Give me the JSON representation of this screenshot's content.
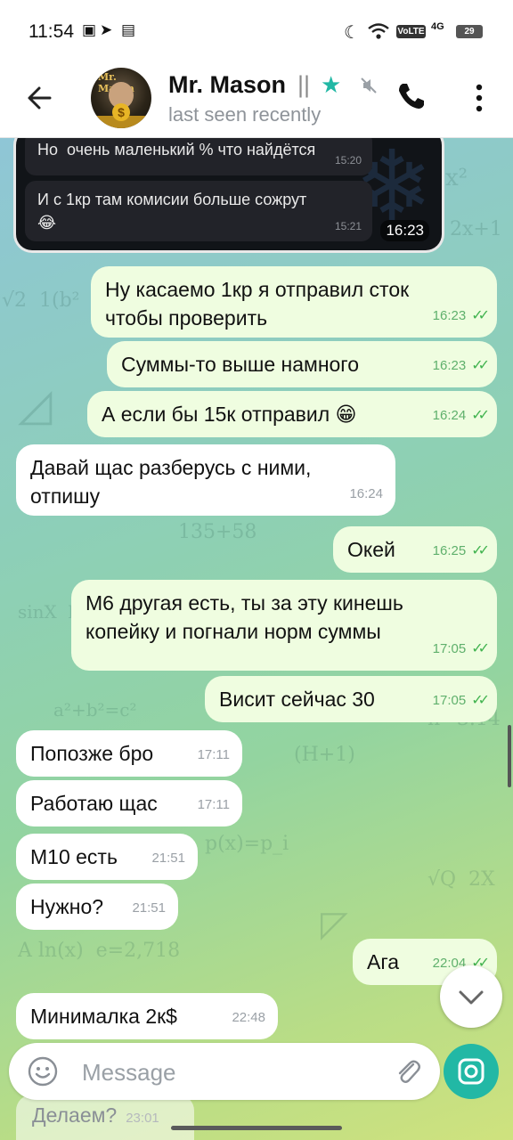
{
  "status_bar": {
    "time": "11:54",
    "indicators": [
      "moon-icon",
      "wifi-icon",
      "volte",
      "4g",
      "battery"
    ],
    "volte": "VoLTE",
    "network": "4G",
    "battery": "29"
  },
  "header": {
    "contact_name": "Mr. Mason",
    "separator": "||",
    "status": "last seen recently",
    "avatar_caption": "Mr. Mason"
  },
  "forwarded": {
    "messages": [
      {
        "text": "Но  очень маленький % что найдётся",
        "time": "15:20"
      },
      {
        "text": "И с 1кр там комисии больше сожрут\n😂",
        "time": "15:21"
      }
    ],
    "time": "16:23"
  },
  "messages": [
    {
      "dir": "out",
      "text": "Ну касаемо 1кр я отправил сток\nчтобы проверить",
      "time": "16:23"
    },
    {
      "dir": "out",
      "text": "Суммы-то выше намного",
      "time": "16:23"
    },
    {
      "dir": "out",
      "text": "А если бы 15к отправил 😁",
      "time": "16:24"
    },
    {
      "dir": "in",
      "text": "Давай щас разберусь с ними,\nотпишу",
      "time": "16:24"
    },
    {
      "dir": "out",
      "text": "Окей",
      "time": "16:25"
    },
    {
      "dir": "out",
      "text": "М6 другая есть, ты за эту кинешь\nкопейку и погнали норм суммы",
      "time": "17:05"
    },
    {
      "dir": "out",
      "text": "Висит сейчас 30",
      "time": "17:05"
    },
    {
      "dir": "in",
      "text": "Попозже бро",
      "time": "17:11"
    },
    {
      "dir": "in",
      "text": "Работаю щас",
      "time": "17:11"
    },
    {
      "dir": "in",
      "text": "М10 есть",
      "time": "21:51"
    },
    {
      "dir": "in",
      "text": "Нужно?",
      "time": "21:51"
    },
    {
      "dir": "out",
      "text": "Ага",
      "time": "22:04"
    },
    {
      "dir": "in",
      "text": "Минималка 2к$",
      "time": "22:48"
    }
  ],
  "partial_message": {
    "text": "Делаем?",
    "time": "23:01"
  },
  "composer": {
    "placeholder": "Message"
  },
  "checks": "✓✓"
}
